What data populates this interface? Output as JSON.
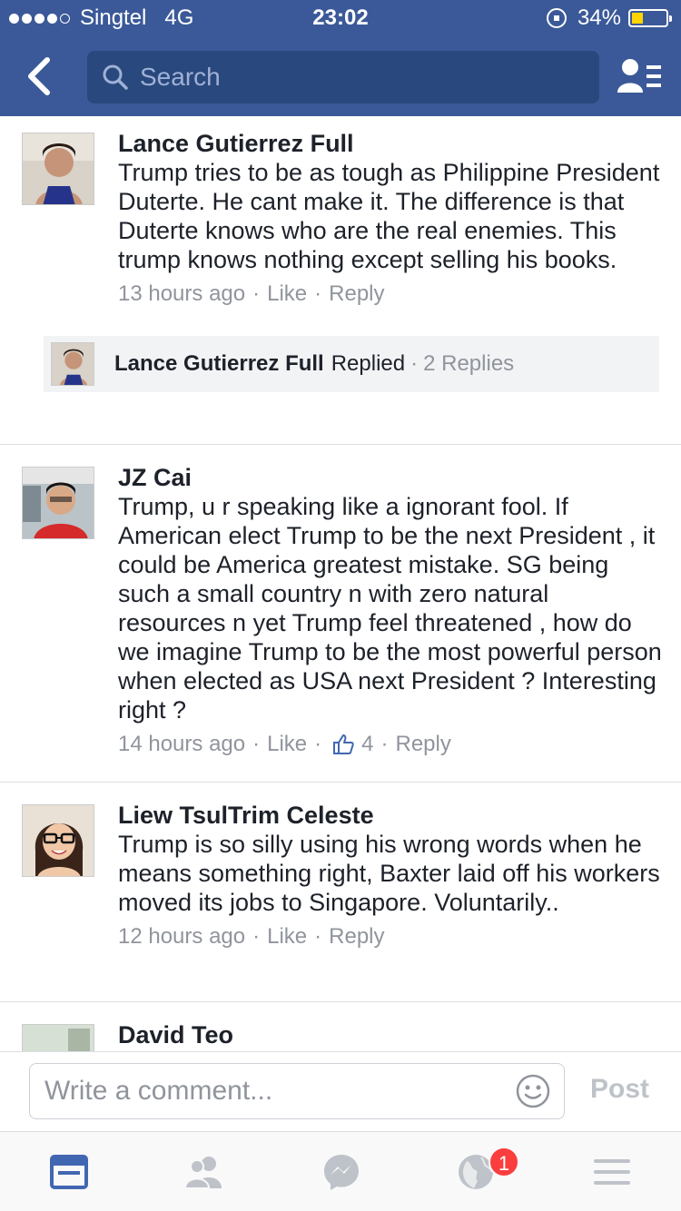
{
  "status_bar": {
    "carrier": "Singtel",
    "network": "4G",
    "time": "23:02",
    "battery": "34%",
    "battery_level": 0.34,
    "signal_bars": 4
  },
  "nav": {
    "search_placeholder": "Search"
  },
  "comments": [
    {
      "name": "Lance Gutierrez Full",
      "text": "Trump tries to be as tough as Philippine President Duterte. He cant make it. The difference is that Duterte knows who are the real enemies. This trump knows nothing except selling his books.",
      "time": "13 hours ago",
      "like": "Like",
      "reply": "Reply",
      "reply_preview": {
        "name": "Lance Gutierrez Full",
        "action": "Replied",
        "count": "2 Replies"
      }
    },
    {
      "name": "JZ Cai",
      "text": "Trump, u r speaking like a ignorant fool. If American elect Trump to be the next President , it could be America greatest mistake. SG being such a small country n with zero natural resources n yet Trump feel threatened , how do we imagine Trump to be the most powerful person when elected as USA next President ? Interesting right ?",
      "time": "14 hours ago",
      "like": "Like",
      "likes_count": "4",
      "reply": "Reply"
    },
    {
      "name": "Liew TsulTrim Celeste",
      "text": "Trump is so silly using his wrong words when he means something right, Baxter laid off his workers moved its jobs to Singapore. Voluntarily..",
      "time": "12 hours ago",
      "like": "Like",
      "reply": "Reply"
    },
    {
      "name": "David Teo"
    }
  ],
  "composer": {
    "placeholder": "Write a comment...",
    "post_label": "Post"
  },
  "tabbar": {
    "notifications_badge": "1"
  },
  "colors": {
    "brand": "#3b5998",
    "search_bg": "#29487d",
    "meta_text": "#90949c",
    "active_tab": "#4267b2",
    "badge": "#fa3e3e"
  }
}
